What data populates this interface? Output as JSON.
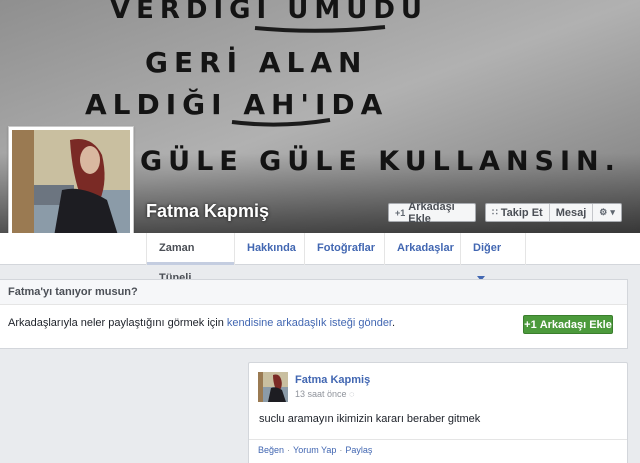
{
  "cover": {
    "handwritten_lines": [
      "VERDIĞI UMUDU",
      "GERİ ALAN",
      "ALDIĞI AH'IDA",
      "GÜLE GÜLE KULLANSIN."
    ]
  },
  "profile": {
    "name": "Fatma Kapmiş"
  },
  "header_buttons": {
    "add_friend": "Arkadaşı Ekle",
    "follow": "Takip Et",
    "message": "Mesaj"
  },
  "tabs": [
    {
      "label": "Zaman Tüneli"
    },
    {
      "label": "Hakkında"
    },
    {
      "label": "Fotoğraflar"
    },
    {
      "label": "Arkadaşlar"
    },
    {
      "label": "Diğer"
    }
  ],
  "know_card": {
    "title": "Fatma'yı tanıyor musun?",
    "text_prefix": "Arkadaşlarıyla neler paylaştığını görmek için ",
    "link_text": "kendisine arkadaşlık isteği gönder",
    "text_suffix": ".",
    "button": "Arkadaşı Ekle"
  },
  "post": {
    "author": "Fatma Kapmiş",
    "time": "13 saat önce",
    "text": "suclu aramayın ikimizin kararı beraber gitmek",
    "actions": [
      "Beğen",
      "Yorum Yap",
      "Paylaş"
    ]
  },
  "colors": {
    "link": "#4267b2",
    "green_button": "#4c9a3c",
    "background": "#e9ebee"
  },
  "icons": {
    "add_friend": "person-plus-icon",
    "follow": "rss-icon",
    "settings": "gear-icon",
    "privacy": "globe-icon"
  }
}
